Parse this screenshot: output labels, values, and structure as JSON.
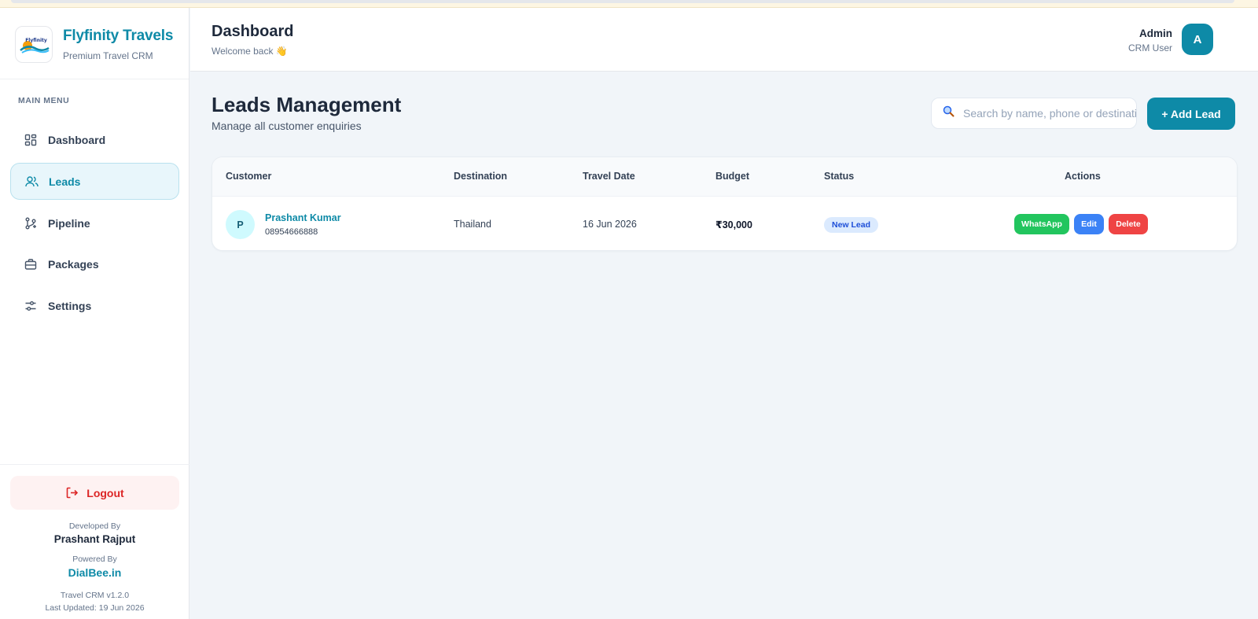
{
  "brand": {
    "name": "Flyfinity Travels",
    "tagline": "Premium Travel CRM",
    "logo_text": "Flyfinity"
  },
  "sidebar": {
    "menu_title": "MAIN MENU",
    "items": [
      {
        "label": "Dashboard",
        "icon": "grid-icon"
      },
      {
        "label": "Leads",
        "icon": "users-icon"
      },
      {
        "label": "Pipeline",
        "icon": "git-branch-icon"
      },
      {
        "label": "Packages",
        "icon": "briefcase-icon"
      },
      {
        "label": "Settings",
        "icon": "sliders-icon"
      }
    ],
    "active": "Leads",
    "logout_label": "Logout",
    "developed_by_label": "Developed By",
    "developer": "Prashant Rajput",
    "powered_by_label": "Powered By",
    "powered_by": "DialBee.in",
    "version": "Travel CRM v1.2.0",
    "last_updated": "Last Updated: 19 Jun 2026"
  },
  "header": {
    "title": "Dashboard",
    "subtitle": "Welcome back 👋",
    "user_name": "Admin",
    "user_role": "CRM User",
    "avatar_initial": "A"
  },
  "main": {
    "title": "Leads Management",
    "subtitle": "Manage all customer enquiries",
    "search_placeholder": "Search by name, phone or destination",
    "add_button": "+ Add Lead",
    "table": {
      "columns": [
        "Customer",
        "Destination",
        "Travel Date",
        "Budget",
        "Status",
        "Actions"
      ],
      "rows": [
        {
          "initial": "P",
          "name": "Prashant Kumar",
          "phone": "08954666888",
          "destination": "Thailand",
          "travel_date": "16 Jun 2026",
          "budget": "₹30,000",
          "status": "New Lead",
          "actions": [
            "WhatsApp",
            "Edit",
            "Delete"
          ]
        }
      ]
    }
  },
  "colors": {
    "accent": "#0e8aa7",
    "whatsapp": "#22c55e",
    "edit": "#3b82f6",
    "delete": "#ef4444",
    "logout": "#dc2626"
  }
}
